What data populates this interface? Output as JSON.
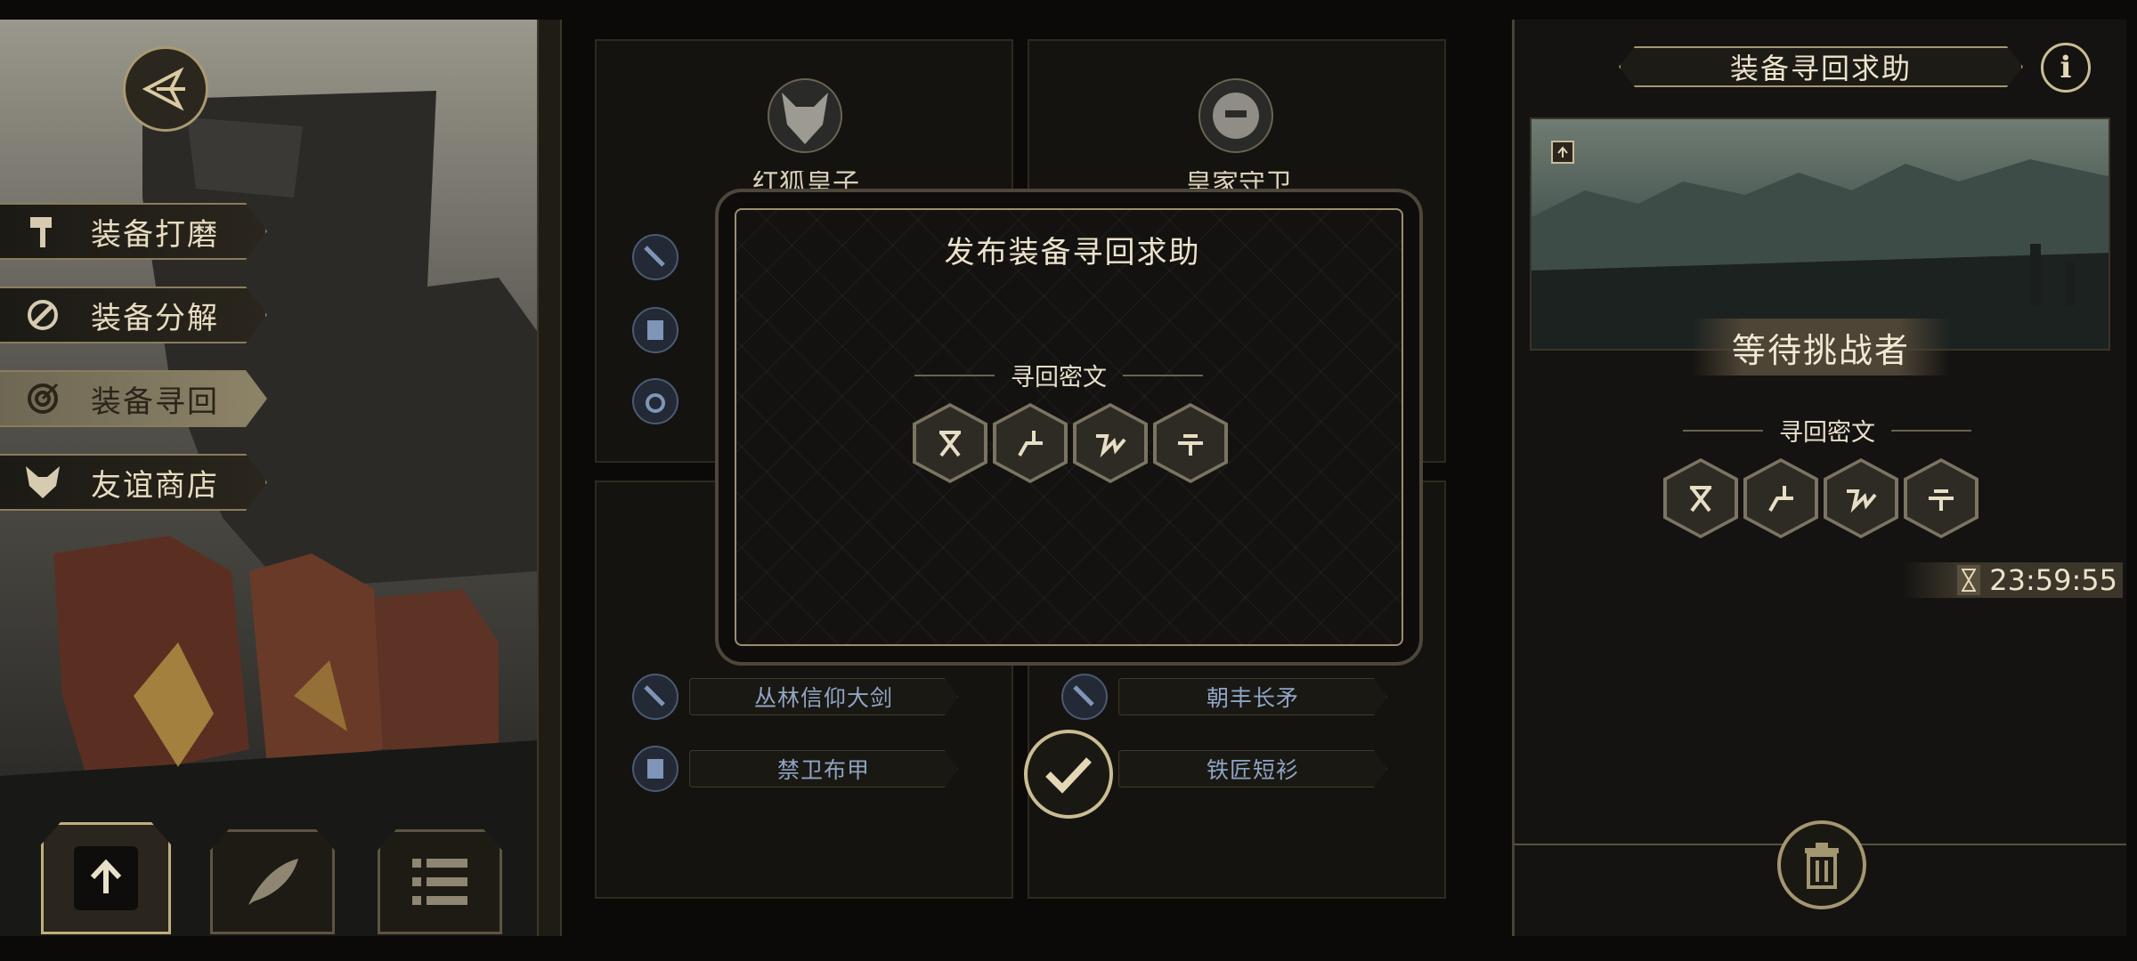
{
  "side_menu": {
    "items": [
      {
        "label": "装备打磨",
        "icon": "hammer-icon",
        "active": false
      },
      {
        "label": "装备分解",
        "icon": "disassemble-icon",
        "active": false
      },
      {
        "label": "装备寻回",
        "icon": "target-icon",
        "active": true
      },
      {
        "label": "友谊商店",
        "icon": "fox-head-icon",
        "active": false
      }
    ]
  },
  "bottom_buttons": [
    {
      "icon": "upload-file-icon"
    },
    {
      "icon": "feather-icon"
    },
    {
      "icon": "list-icon"
    }
  ],
  "columns": {
    "left_top": {
      "character_name": "红狐皇子"
    },
    "right_top": {
      "character_name": "皇家守卫"
    },
    "left_bottom": {
      "items": [
        "丛林信仰大剑",
        "禁卫布甲"
      ]
    },
    "right_bottom": {
      "items": [
        "朝丰长矛",
        "铁匠短衫"
      ]
    }
  },
  "modal": {
    "title": "发布装备寻回求助",
    "cipher_label": "寻回密文",
    "runes": [
      "rune-1-icon",
      "rune-2-icon",
      "rune-3-icon",
      "rune-4-icon"
    ]
  },
  "right_panel": {
    "title": "装备寻回求助",
    "status": "等待挑战者",
    "cipher_label": "寻回密文",
    "timer": "23:59:55"
  },
  "colors": {
    "gold": "#a99a72",
    "item_text": "#8fa4c6"
  }
}
